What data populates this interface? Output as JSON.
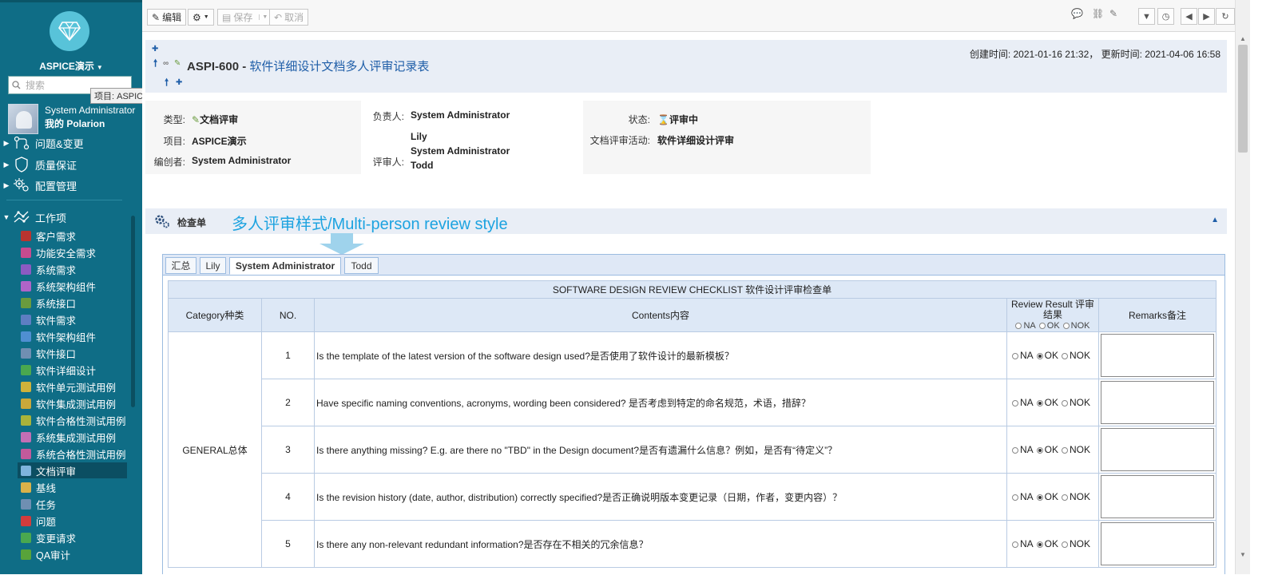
{
  "sidebar": {
    "project": "ASPICE演示",
    "search_placeholder": "搜索",
    "tooltip": "项目: ASPICE演示",
    "user_name": "System Administrator",
    "my_polarion": "我的 Polarion",
    "groups": [
      {
        "label": "问题&变更"
      },
      {
        "label": "质量保证"
      },
      {
        "label": "配置管理"
      },
      {
        "label": "工作项"
      }
    ],
    "items": [
      {
        "label": "客户需求",
        "color": "#b9342f"
      },
      {
        "label": "功能安全需求",
        "color": "#c74b8f"
      },
      {
        "label": "系统需求",
        "color": "#8b5bc2"
      },
      {
        "label": "系统架构组件",
        "color": "#b064c8"
      },
      {
        "label": "系统接口",
        "color": "#6a9b3e"
      },
      {
        "label": "软件需求",
        "color": "#5e7ec2"
      },
      {
        "label": "软件架构组件",
        "color": "#4f8fd1"
      },
      {
        "label": "软件接口",
        "color": "#6f8fb2"
      },
      {
        "label": "软件详细设计",
        "color": "#4aa84f"
      },
      {
        "label": "软件单元测试用例",
        "color": "#d0b23a"
      },
      {
        "label": "软件集成测试用例",
        "color": "#c9a83a"
      },
      {
        "label": "软件合格性测试用例",
        "color": "#a8b33a"
      },
      {
        "label": "系统集成测试用例",
        "color": "#c26fb5"
      },
      {
        "label": "系统合格性测试用例",
        "color": "#c25a9b"
      },
      {
        "label": "文档评审",
        "color": "#7fb4dd"
      },
      {
        "label": "基线",
        "color": "#d9b24a"
      },
      {
        "label": "任务",
        "color": "#6f8fb2"
      },
      {
        "label": "问题",
        "color": "#d23c3c"
      },
      {
        "label": "变更请求",
        "color": "#4aa84f"
      },
      {
        "label": "QA审计",
        "color": "#58a33a"
      }
    ]
  },
  "toolbar": {
    "edit": "编辑",
    "save": "保存",
    "cancel": "取消"
  },
  "header": {
    "id": "ASPI-600",
    "sep": " - ",
    "title": "软件详细设计文档多人评审记录表",
    "dates": "创建时间: 2021-01-16 21:32，  更新时间: 2021-04-06 16:58"
  },
  "fields": {
    "type_label": "类型:",
    "type_value": "文档评审",
    "project_label": "项目:",
    "project_value": "ASPICE演示",
    "author_label": "编创者:",
    "author_value": "System Administrator",
    "assignee_label": "负责人:",
    "assignee_value": "System Administrator",
    "reviewer_label": "评审人:",
    "reviewers": [
      "Lily",
      "System Administrator",
      "Todd"
    ],
    "status_label": "状态:",
    "status_value": "评审中",
    "activity_label": "文档评审活动:",
    "activity_value": "软件详细设计评审"
  },
  "checklist": {
    "label": "检查单",
    "note": "多人评审样式/Multi-person review style",
    "tabs": [
      "汇总",
      "Lily",
      "System Administrator",
      "Todd"
    ],
    "active_tab": 2,
    "caption": "SOFTWARE DESIGN REVIEW CHECKLIST 软件设计评审检查单",
    "headers": {
      "category": "Category种类",
      "no": "NO.",
      "contents": "Contents内容",
      "result": "Review Result 评审结果",
      "remarks": "Remarks备注"
    },
    "options": [
      "NA",
      "OK",
      "NOK"
    ],
    "category_value": "GENERAL总体",
    "rows": [
      {
        "no": "1",
        "content": "Is the template of the latest version of the software design used?是否使用了软件设计的最新模板？",
        "result": "OK"
      },
      {
        "no": "2",
        "content": "Have specific naming conventions, acronyms, wording been considered? 是否考虑到特定的命名规范，术语，措辞？",
        "result": "OK"
      },
      {
        "no": "3",
        "content": "Is there anything missing? E.g. are there no \"TBD\" in the Design document?是否有遗漏什么信息？例如，是否有“待定义”？",
        "result": "OK"
      },
      {
        "no": "4",
        "content": "Is the revision history (date, author, distribution) correctly specified?是否正确说明版本变更记录（日期，作者，变更内容）？",
        "result": "OK"
      },
      {
        "no": "5",
        "content": "Is there any non-relevant redundant information?是否存在不相关的冗余信息？",
        "result": "OK"
      }
    ]
  }
}
